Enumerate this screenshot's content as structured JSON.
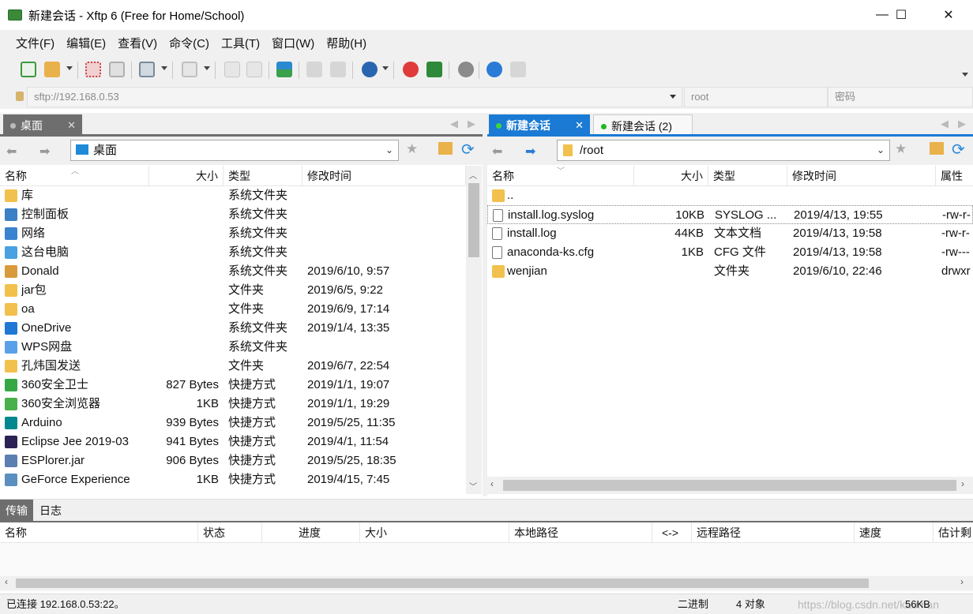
{
  "window": {
    "title": "新建会话 - Xftp 6 (Free for Home/School)",
    "minimize": "—",
    "maximize": "☐",
    "close": "✕"
  },
  "menu": [
    "文件(F)",
    "编辑(E)",
    "查看(V)",
    "命令(C)",
    "工具(T)",
    "窗口(W)",
    "帮助(H)"
  ],
  "address": {
    "host": "sftp://192.168.0.53",
    "user_placeholder": "root",
    "password_placeholder": "密码"
  },
  "left_panel": {
    "tab_label": "桌面",
    "path": "桌面",
    "columns": [
      "名称",
      "大小",
      "类型",
      "修改时间"
    ],
    "rows": [
      {
        "name": "库",
        "size": "",
        "type": "系统文件夹",
        "mtime": "",
        "icon": "library-folder-icon",
        "color": "#f2c04c"
      },
      {
        "name": "控制面板",
        "size": "",
        "type": "系统文件夹",
        "mtime": "",
        "icon": "control-panel-icon",
        "color": "#3b7fc4"
      },
      {
        "name": "网络",
        "size": "",
        "type": "系统文件夹",
        "mtime": "",
        "icon": "network-icon",
        "color": "#3a83d1"
      },
      {
        "name": "这台电脑",
        "size": "",
        "type": "系统文件夹",
        "mtime": "",
        "icon": "computer-icon",
        "color": "#4aa0e0"
      },
      {
        "name": "Donald",
        "size": "",
        "type": "系统文件夹",
        "mtime": "2019/6/10, 9:57",
        "icon": "user-folder-icon",
        "color": "#d99a3a"
      },
      {
        "name": "jar包",
        "size": "",
        "type": "文件夹",
        "mtime": "2019/6/5, 9:22",
        "icon": "folder-icon",
        "color": "#f2c04c"
      },
      {
        "name": "oa",
        "size": "",
        "type": "文件夹",
        "mtime": "2019/6/9, 17:14",
        "icon": "folder-icon",
        "color": "#f2c04c"
      },
      {
        "name": "OneDrive",
        "size": "",
        "type": "系统文件夹",
        "mtime": "2019/1/4, 13:35",
        "icon": "onedrive-icon",
        "color": "#1e78d4"
      },
      {
        "name": "WPS网盘",
        "size": "",
        "type": "系统文件夹",
        "mtime": "",
        "icon": "cloud-icon",
        "color": "#5aa0e8"
      },
      {
        "name": "孔炜国发送",
        "size": "",
        "type": "文件夹",
        "mtime": "2019/6/7, 22:54",
        "icon": "folder-icon",
        "color": "#f2c04c"
      },
      {
        "name": "360安全卫士",
        "size": "827 Bytes",
        "type": "快捷方式",
        "mtime": "2019/1/1, 19:07",
        "icon": "shortcut-360-icon",
        "color": "#35a845"
      },
      {
        "name": "360安全浏览器",
        "size": "1KB",
        "type": "快捷方式",
        "mtime": "2019/1/1, 19:29",
        "icon": "shortcut-browser-icon",
        "color": "#4ab04a"
      },
      {
        "name": "Arduino",
        "size": "939 Bytes",
        "type": "快捷方式",
        "mtime": "2019/5/25, 11:35",
        "icon": "shortcut-arduino-icon",
        "color": "#00878f"
      },
      {
        "name": "Eclipse Jee 2019-03",
        "size": "941 Bytes",
        "type": "快捷方式",
        "mtime": "2019/4/1, 11:54",
        "icon": "shortcut-eclipse-icon",
        "color": "#2c2255"
      },
      {
        "name": "ESPlorer.jar",
        "size": "906 Bytes",
        "type": "快捷方式",
        "mtime": "2019/5/25, 18:35",
        "icon": "shortcut-jar-icon",
        "color": "#5a7fb0"
      },
      {
        "name": "GeForce Experience",
        "size": "1KB",
        "type": "快捷方式",
        "mtime": "2019/4/15, 7:45",
        "icon": "shortcut-geforce-icon",
        "color": "#5a8fc0"
      }
    ]
  },
  "right_panel": {
    "tab_active": "新建会话",
    "tab_second": "新建会话 (2)",
    "path": "/root",
    "columns": [
      "名称",
      "大小",
      "类型",
      "修改时间",
      "属性"
    ],
    "rows": [
      {
        "name": "..",
        "size": "",
        "type": "",
        "mtime": "",
        "attr": "",
        "icon": "folder-icon",
        "color": "#f2c04c"
      },
      {
        "name": "install.log.syslog",
        "size": "10KB",
        "type": "SYSLOG ...",
        "mtime": "2019/4/13, 19:55",
        "attr": "-rw-r-",
        "icon": "file-icon",
        "color": "#ffffff"
      },
      {
        "name": "install.log",
        "size": "44KB",
        "type": "文本文档",
        "mtime": "2019/4/13, 19:58",
        "attr": "-rw-r-",
        "icon": "text-file-icon",
        "color": "#ffffff"
      },
      {
        "name": "anaconda-ks.cfg",
        "size": "1KB",
        "type": "CFG 文件",
        "mtime": "2019/4/13, 19:58",
        "attr": "-rw---",
        "icon": "file-icon",
        "color": "#ffffff"
      },
      {
        "name": "wenjian",
        "size": "",
        "type": "文件夹",
        "mtime": "2019/6/10, 22:46",
        "attr": "drwxr",
        "icon": "folder-icon",
        "color": "#f2c04c"
      }
    ]
  },
  "transfer": {
    "tab_transfer": "传输",
    "tab_log": "日志",
    "columns": [
      "名称",
      "状态",
      "进度",
      "大小",
      "本地路径",
      "<->",
      "远程路径",
      "速度",
      "估计剩"
    ]
  },
  "status": {
    "connection": "已连接 192.168.0.53:22。",
    "mode": "二进制",
    "objects": "4 对象",
    "size": "56KB",
    "watermark": "https://blog.csdn.net/kauman"
  }
}
